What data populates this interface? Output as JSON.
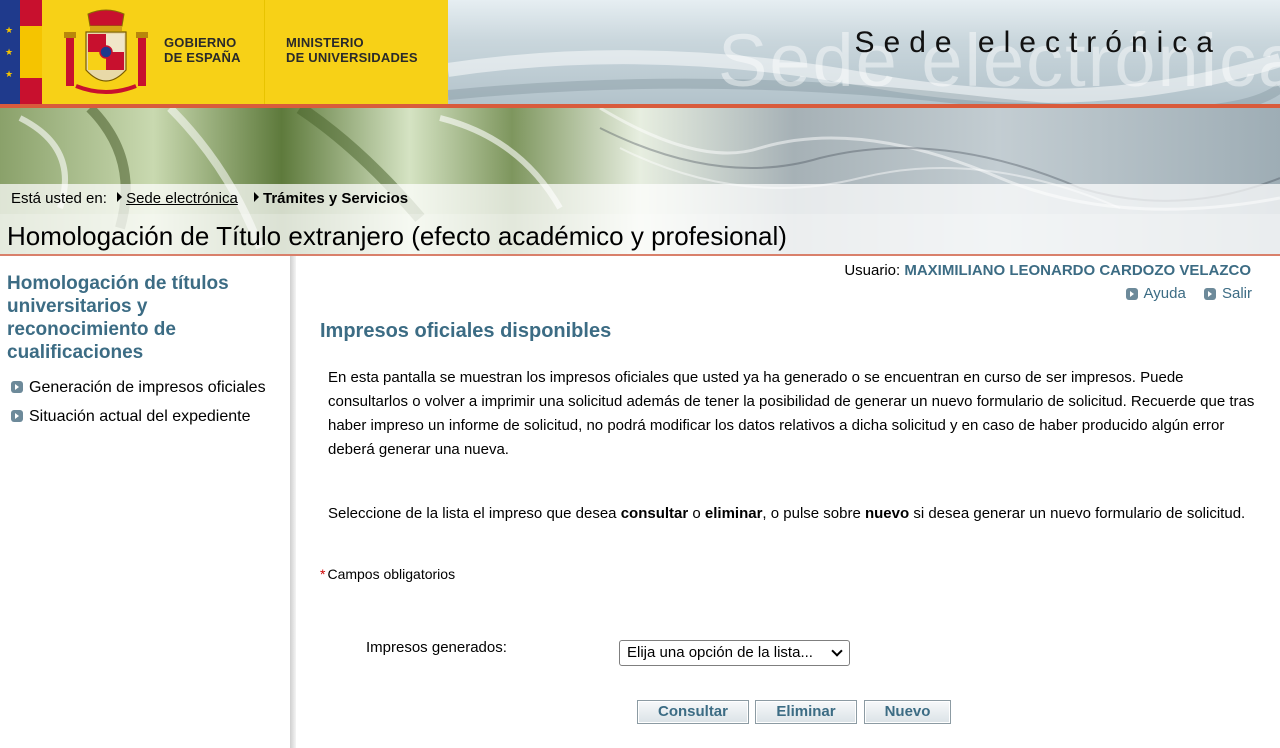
{
  "header": {
    "gov_line1": "GOBIERNO",
    "gov_line2": "DE ESPAÑA",
    "ministry_line1": "MINISTERIO",
    "ministry_line2": "DE UNIVERSIDADES",
    "site_title": "Sede electrónica",
    "colors": {
      "accent_yellow": "#f7d117",
      "accent_red": "#d95b3c",
      "flag_blue": "#1f3a8c"
    }
  },
  "breadcrumb": {
    "prefix": "Está usted en:",
    "items": [
      {
        "label": "Sede electrónica",
        "link": true
      },
      {
        "label": "Trámites y Servicios",
        "link": false
      }
    ]
  },
  "page": {
    "title": "Homologación de Título extranjero (efecto académico y profesional)"
  },
  "sidebar": {
    "heading": "Homologación de títulos universitarios y reconocimiento de cualificaciones",
    "items": [
      {
        "label": "Generación de impresos oficiales",
        "icon": "arrow-bullet-icon"
      },
      {
        "label": "Situación actual del expediente",
        "icon": "arrow-bullet-icon"
      }
    ]
  },
  "user": {
    "label": "Usuario:",
    "name": "MAXIMILIANO LEONARDO CARDOZO VELAZCO"
  },
  "links": {
    "help": "Ayuda",
    "logout": "Salir"
  },
  "main": {
    "section_title": "Impresos oficiales disponibles",
    "intro": "En esta pantalla se muestran los impresos oficiales que usted ya ha generado o se encuentran en curso de ser impresos. Puede consultarlos o volver a imprimir una solicitud además de tener la posibilidad de generar un nuevo formulario de solicitud. Recuerde que tras haber impreso un informe de solicitud, no podrá modificar los datos relativos a dicha solicitud y en caso de haber producido algún error deberá generar una nueva.",
    "instruction": {
      "part1": "Seleccione de la lista el impreso que desea ",
      "bold1": "consultar",
      "part2": " o ",
      "bold2": "eliminar",
      "part3": ", o pulse sobre ",
      "bold3": "nuevo",
      "part4": " si desea generar un nuevo formulario de solicitud."
    },
    "required_marker": "*",
    "required_note": "Campos obligatorios",
    "select_label": "Impresos generados:",
    "select_value": "Elija una opción de la lista...",
    "buttons": {
      "consult": "Consultar",
      "delete": "Eliminar",
      "new": "Nuevo"
    }
  }
}
